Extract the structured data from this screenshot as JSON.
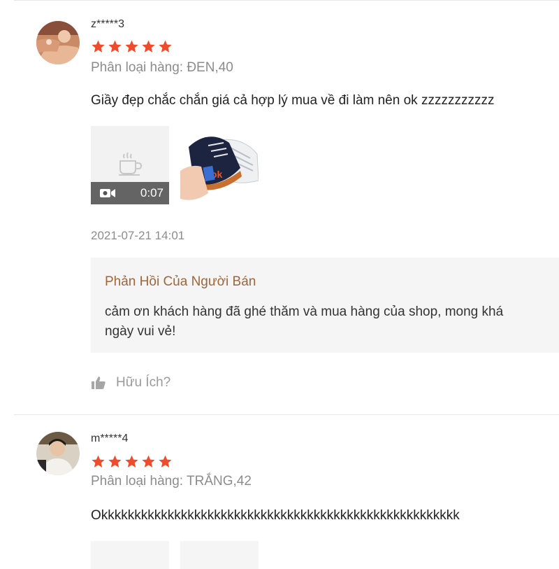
{
  "reviews": [
    {
      "username": "z*****3",
      "rating": 5,
      "variation": "Phân loại hàng: ĐEN,40",
      "comment": "Giầy đẹp chắc chắn giá cả hợp lý mua về đi làm nên ok zzzzzzzzzzz",
      "video_duration": "0:07",
      "timestamp": "2021-07-21 14:01",
      "seller_reply": {
        "title": "Phản Hồi Của Người Bán",
        "line1": "cảm ơn khách hàng đã ghé thăm và mua hàng của shop, mong khá",
        "line2": "ngày vui vẻ!"
      },
      "helpful_label": "Hữu Ích?"
    },
    {
      "username": "m*****4",
      "rating": 5,
      "variation": "Phân loại hàng: TRẮNG,42",
      "comment": "Okkkkkkkkkkkkkkkkkkkkkkkkkkkkkkkkkkkkkkkkkkkkkkkkkkkkkk"
    }
  ],
  "colors": {
    "star": "#ee4d2d",
    "seller_title": "#a0653a",
    "muted": "#8c8c8c",
    "reply_bg": "#f5f5f5"
  },
  "icons": [
    "star-icon",
    "video-camera-icon",
    "image-placeholder-icon",
    "thumbs-up-icon"
  ]
}
